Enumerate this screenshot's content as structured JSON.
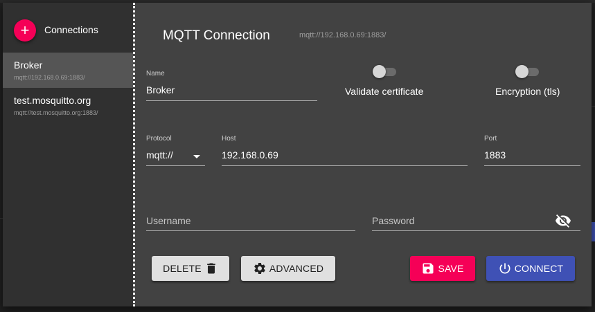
{
  "sidebar": {
    "title": "Connections",
    "add_icon": "+",
    "items": [
      {
        "name": "Broker",
        "url": "mqtt://192.168.0.69:1883/",
        "active": true
      },
      {
        "name": "test.mosquitto.org",
        "url": "mqtt://test.mosquitto.org:1883/",
        "active": false
      }
    ]
  },
  "header": {
    "title": "MQTT Connection",
    "url": "mqtt://192.168.0.69:1883/"
  },
  "form": {
    "name_label": "Name",
    "name_value": "Broker",
    "validate_label": "Validate certificate",
    "validate_on": false,
    "encryption_label": "Encryption (tls)",
    "encryption_on": false,
    "protocol_label": "Protocol",
    "protocol_value": "mqtt://",
    "host_label": "Host",
    "host_value": "192.168.0.69",
    "port_label": "Port",
    "port_value": "1883",
    "username_placeholder": "Username",
    "password_placeholder": "Password"
  },
  "actions": {
    "delete_label": "DELETE",
    "advanced_label": "ADVANCED",
    "save_label": "SAVE",
    "connect_label": "CONNECT"
  },
  "icons": {
    "add": "plus-icon",
    "delete": "trash-icon",
    "advanced": "gear-icon",
    "save": "floppy-disk-icon",
    "connect": "power-icon",
    "password_visibility": "eye-off-icon",
    "protocol_dropdown": "caret-down-icon"
  },
  "colors": {
    "accent_pink": "#f50057",
    "primary_indigo": "#3f51b5",
    "dialog_bg": "#424242",
    "sidebar_bg": "#303030"
  }
}
